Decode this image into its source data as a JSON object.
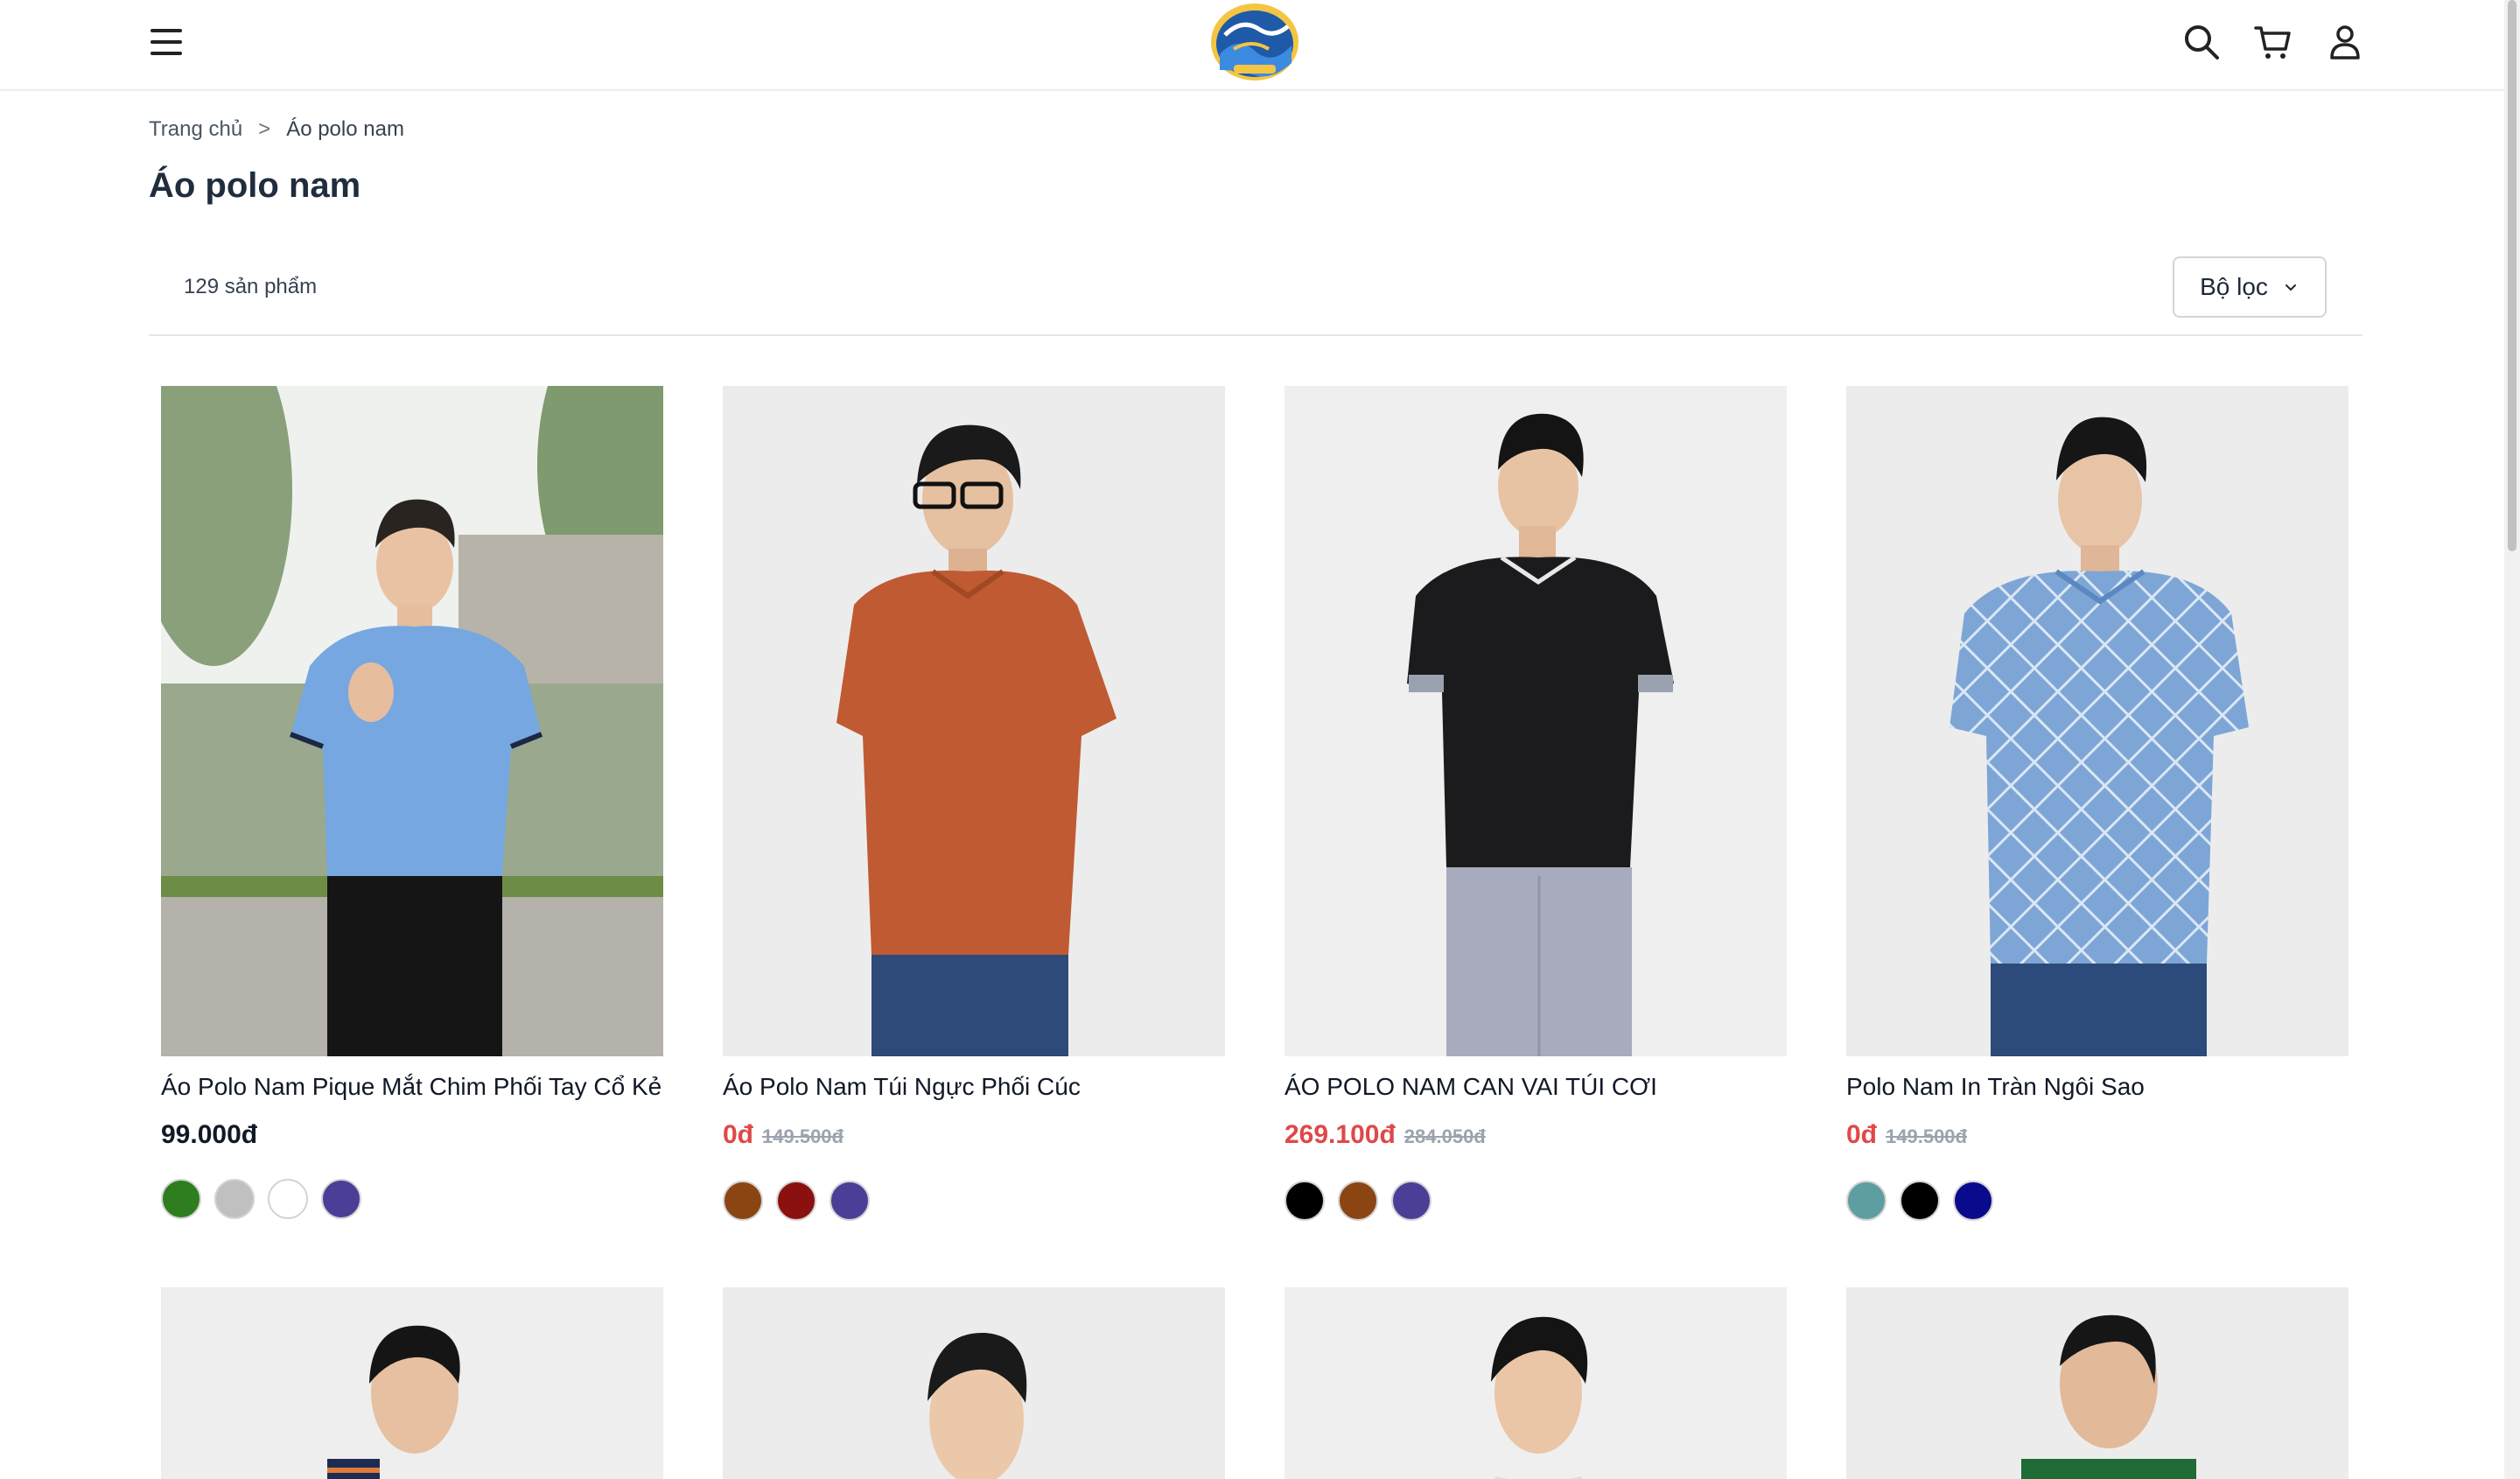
{
  "header": {
    "menu_label": "menu",
    "logo_name": "site-logo",
    "icons": [
      "search-icon",
      "cart-icon",
      "user-icon"
    ]
  },
  "breadcrumb": {
    "home": "Trang chủ",
    "separator": ">",
    "current": "Áo polo nam"
  },
  "page_title": "Áo polo nam",
  "toolbar": {
    "count": "129 sản phẩm",
    "filter_label": "Bộ lọc"
  },
  "colors": {
    "sale_price": "#e04848",
    "old_price": "#9ca3af"
  },
  "products": [
    {
      "name": "Áo Polo Nam Pique Mắt Chim Phối Tay Cổ Kẻ",
      "price": "99.000đ",
      "old_price": "",
      "on_sale": false,
      "swatches": [
        "#2e7d1f",
        "#c0c0c0",
        "#ffffff",
        "#4a3f96"
      ]
    },
    {
      "name": "Áo Polo Nam Túi Ngực Phối Cúc",
      "price": "0đ",
      "old_price": "149.500đ",
      "on_sale": true,
      "swatches": [
        "#8b4513",
        "#8b1010",
        "#4a3f96"
      ]
    },
    {
      "name": "ÁO POLO NAM CAN VAI TÚI CƠI",
      "price": "269.100đ",
      "old_price": "284.050đ",
      "on_sale": true,
      "swatches": [
        "#000000",
        "#8b4513",
        "#4a3f96"
      ]
    },
    {
      "name": "Polo Nam In Tràn Ngôi Sao",
      "price": "0đ",
      "old_price": "149.500đ",
      "on_sale": true,
      "swatches": [
        "#5f9ea0",
        "#000000",
        "#0a0a8c"
      ]
    }
  ]
}
